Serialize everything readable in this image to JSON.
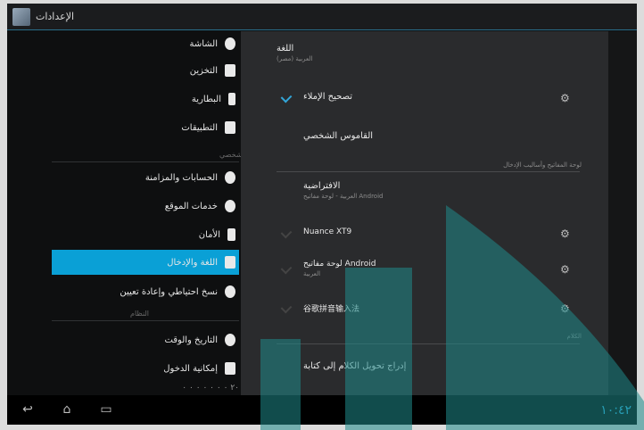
{
  "action_bar": {
    "title": "الإعدادات"
  },
  "left_nav": {
    "items": [
      {
        "label": "الشاشة"
      },
      {
        "label": "التخزين"
      },
      {
        "label": "البطارية"
      },
      {
        "label": "التطبيقات"
      },
      {
        "label": "الحسابات والمزامنة"
      },
      {
        "label": "خدمات الموقع"
      },
      {
        "label": "الأمان"
      },
      {
        "label": "اللغة والإدخال"
      },
      {
        "label": "نسخ احتياطي وإعادة تعيين"
      },
      {
        "label": "التاريخ والوقت"
      },
      {
        "label": "إمكانية الدخول"
      },
      {
        "label": "٢٠ ٠ ٠ ٠ ٠ ٠ ٠ ٠"
      }
    ],
    "headers": {
      "personal": "شخصي",
      "system": "النظام"
    }
  },
  "right_pane": {
    "language": {
      "title": "اللغة",
      "summary": "العربية (مصر)"
    },
    "spell_checker": {
      "title": "تصحيح الإملاء"
    },
    "personal_dictionary": {
      "title": "القاموس الشخصي"
    },
    "keyboard_header": "لوحة المفاتيح وأساليب الإدخال",
    "default": {
      "title": "الافتراضية",
      "summary": "العربية - لوحة مفاتيح Android"
    },
    "keyboards": [
      {
        "title": "Nuance XT9"
      },
      {
        "title": "لوحة مفاتيح Android",
        "summary": "العربية"
      },
      {
        "title": "谷歌拼音输入法"
      }
    ],
    "speech_header": "الكلام",
    "voice_search": {
      "title": "إدراج تحويل الكلام إلى كتابة"
    }
  },
  "status_bar": {
    "clock": "١٠:٤٢"
  },
  "colors": {
    "accent": "#0aa0d6",
    "clock": "#32b4e8"
  }
}
